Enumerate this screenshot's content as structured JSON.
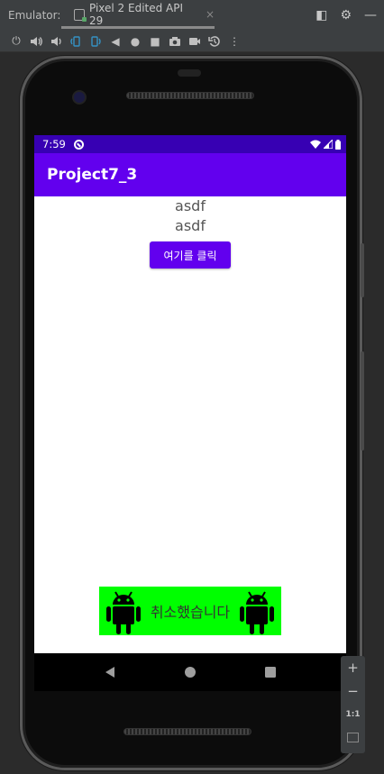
{
  "ide": {
    "emulator_label": "Emulator:",
    "tab_title": "Pixel 2 Edited API 29",
    "tab_close": "×"
  },
  "toolbar": {
    "icons": [
      "power-icon",
      "volume-up-icon",
      "volume-down-icon",
      "rotate-left-icon",
      "rotate-right-icon",
      "back-icon",
      "home-icon",
      "overview-icon",
      "screenshot-icon",
      "screenrecord-icon",
      "snapshot-icon",
      "more-icon"
    ]
  },
  "device": {
    "status_time": "7:59",
    "app_title": "Project7_3",
    "text_line_1": "asdf",
    "text_line_2": "asdf",
    "button_label": "여기를 클릭",
    "toast_text": "취소했습니다",
    "colors": {
      "status_bar": "#3700b3",
      "app_bar": "#6200ee",
      "button": "#6200ee",
      "toast_bg": "#00ff00"
    }
  },
  "zoom": {
    "zoom_in": "+",
    "zoom_out": "−",
    "actual_size": "1:1"
  }
}
